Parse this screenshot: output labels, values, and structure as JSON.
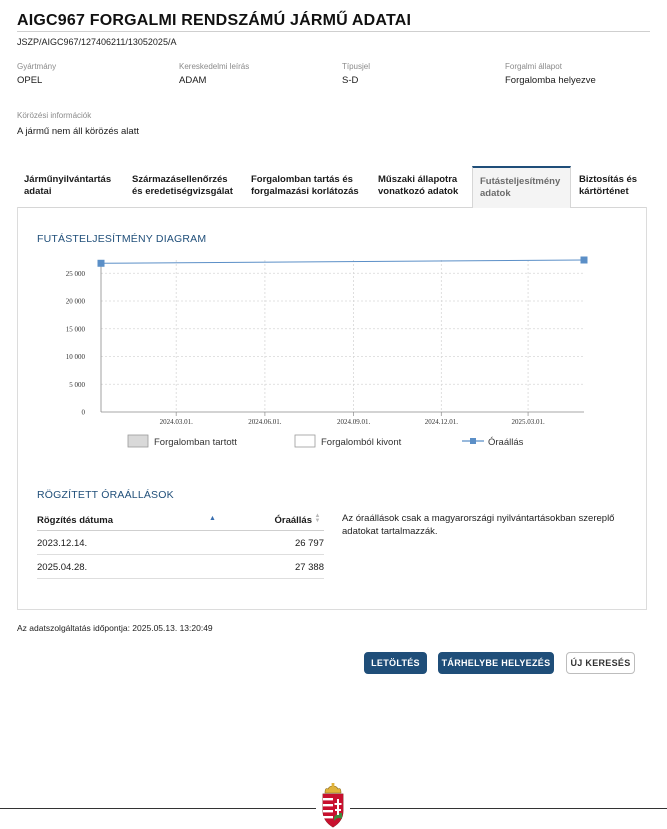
{
  "header": {
    "title": "AIGC967 FORGALMI RENDSZÁMÚ JÁRMŰ ADATAI",
    "reference": "JSZP/AIGC967/127406211/13052025/A"
  },
  "vehicle_fields": [
    {
      "label": "Gyártmány",
      "value": "OPEL"
    },
    {
      "label": "Kereskedelmi leírás",
      "value": "ADAM"
    },
    {
      "label": "Típusjel",
      "value": "S-D"
    },
    {
      "label": "Forgalmi állapot",
      "value": "Forgalomba helyezve"
    }
  ],
  "circulation": {
    "label": "Körözési információk",
    "value": "A jármű nem áll körözés alatt"
  },
  "tabs": [
    {
      "line1": "Járműnyilvántartás",
      "line2": "adatai",
      "active": false
    },
    {
      "line1": "Származásellenőrzés",
      "line2": "és eredetiségvizsgálat",
      "active": false
    },
    {
      "line1": "Forgalomban tartás és",
      "line2": "forgalmazási korlátozás",
      "active": false
    },
    {
      "line1": "Műszaki állapotra",
      "line2": "vonatkozó adatok",
      "active": false
    },
    {
      "line1": "Futásteljesítmény",
      "line2": "adatok",
      "active": true
    },
    {
      "line1": "Biztosítás és",
      "line2": "kártörténet",
      "active": false
    }
  ],
  "chart_section_title": "FUTÁSTELJESÍTMÉNY DIAGRAM",
  "chart_data": {
    "type": "line",
    "series": [
      {
        "name": "Óraállás",
        "x": [
          "2023.12.14.",
          "2025.04.28."
        ],
        "values": [
          26797,
          27388
        ],
        "color": "#5b8fc7"
      }
    ],
    "x_tick_labels": [
      "2024.03.01.",
      "2024.06.01.",
      "2024.09.01.",
      "2024.12.01.",
      "2025.03.01."
    ],
    "x_ticks": [
      "2024-03-01",
      "2024-06-01",
      "2024-09-01",
      "2024-12-01",
      "2025-03-01"
    ],
    "x_range": [
      "2023-12-14",
      "2025-04-28"
    ],
    "y_ticks": [
      0,
      5000,
      10000,
      15000,
      20000,
      25000
    ],
    "y_tick_labels": [
      "0",
      "5 000",
      "10 000",
      "15 000",
      "20 000",
      "25 000"
    ],
    "ylim": [
      0,
      27388
    ],
    "grid": true,
    "legend": [
      {
        "label": "Forgalomban tartott",
        "kind": "band",
        "color": "#d9d9d9"
      },
      {
        "label": "Forgalomból kivont",
        "kind": "band",
        "color": "#ffffff"
      },
      {
        "label": "Óraállás",
        "kind": "line",
        "color": "#5b8fc7"
      }
    ],
    "legend_position": "bottom"
  },
  "readings_section_title": "RÖGZÍTETT ÓRAÁLLÁSOK",
  "readings_table": {
    "headers": [
      "Rögzítés dátuma",
      "Óraállás"
    ],
    "rows": [
      [
        "2023.12.14.",
        "26 797"
      ],
      [
        "2025.04.28.",
        "27 388"
      ]
    ]
  },
  "note": "Az óraállások csak a magyarországi nyilvántartásokban szereplő adatokat tartalmazzák.",
  "timestamp": "Az adatszolgáltatás időpontja: 2025.05.13. 13:20:49",
  "buttons": {
    "download": "LETÖLTÉS",
    "store": "TÁRHELYBE HELYEZÉS",
    "new_search": "ÚJ KERESÉS"
  },
  "colors": {
    "accent": "#1f4e79",
    "series": "#5b8fc7"
  }
}
